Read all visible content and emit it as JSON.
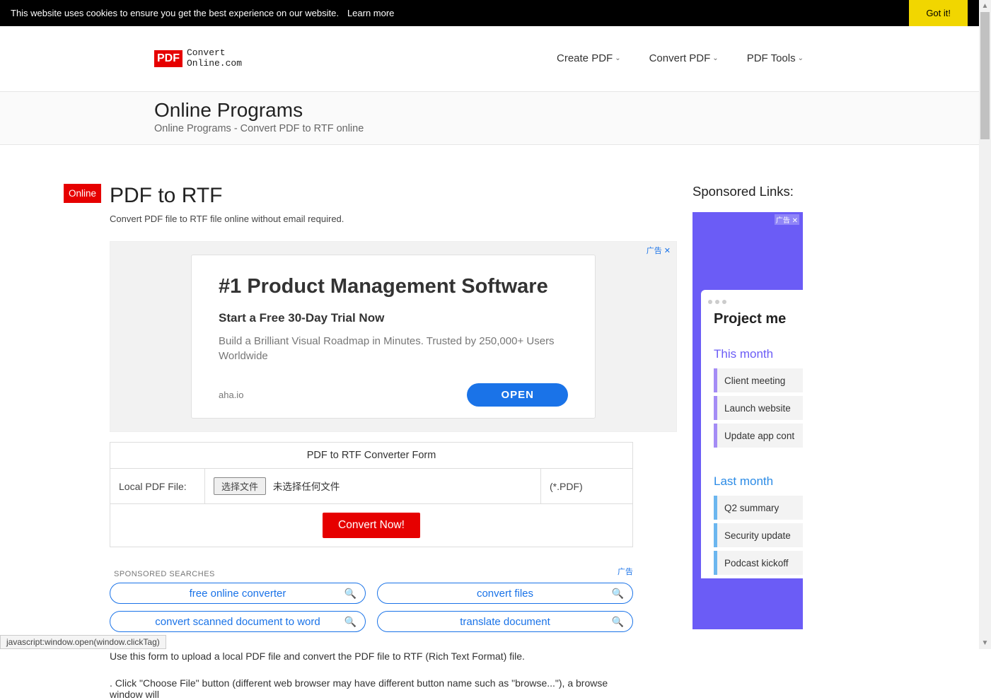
{
  "cookie": {
    "message": "This website uses cookies to ensure you get the best experience on our website.",
    "learn": "Learn more",
    "gotit": "Got it!"
  },
  "logo": {
    "badge": "PDF",
    "line1": "Convert",
    "line2": "Online.com"
  },
  "nav": {
    "create": "Create PDF",
    "convert": "Convert PDF",
    "tools": "PDF Tools"
  },
  "breadcrumb": {
    "title": "Online Programs",
    "sub": "Online Programs - Convert PDF to RTF online"
  },
  "page": {
    "online_tag": "Online",
    "h2": "PDF to RTF",
    "desc": "Convert PDF file to RTF file online without email required."
  },
  "ad1": {
    "label": "广告 ✕",
    "title": "#1 Product Management Software",
    "sub1": "Start a Free 30-Day Trial Now",
    "sub2": "Build a Brilliant Visual Roadmap in Minutes. Trusted by 250,000+ Users Worldwide",
    "domain": "aha.io",
    "open": "OPEN"
  },
  "form": {
    "header": "PDF to RTF Converter Form",
    "label": "Local PDF File:",
    "choose_btn": "选择文件",
    "no_file": "未选择任何文件",
    "ext": "(*.PDF)",
    "convert": "Convert Now!"
  },
  "sponsored": {
    "label": "SPONSORED SEARCHES",
    "adtag": "广告",
    "items": [
      "free online converter",
      "convert files",
      "convert scanned document to word",
      "translate document"
    ]
  },
  "paras": {
    "p1": "Use this form to upload a local PDF file and convert the PDF file to RTF (Rich Text Format) file.",
    "p2": ". Click \"Choose File\" button (different web browser may have different button name such as \"browse...\"), a browse window will"
  },
  "side": {
    "title": "Sponsored Links:",
    "adlabel": "广告 ✕",
    "project_title": "Project me",
    "this_month": "This month",
    "last_month": "Last month",
    "this_items": [
      "Client meeting",
      "Launch website",
      "Update app cont"
    ],
    "last_items": [
      "Q2 summary",
      "Security update",
      "Podcast kickoff"
    ]
  },
  "status": "javascript:window.open(window.clickTag)"
}
